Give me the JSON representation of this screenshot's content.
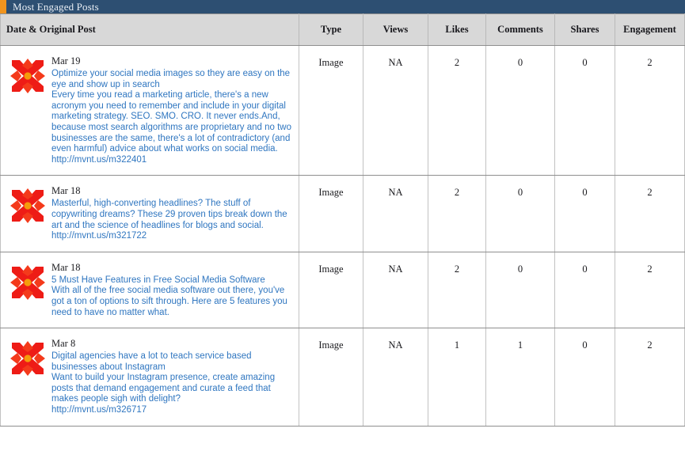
{
  "panel": {
    "title": "Most Engaged Posts",
    "accent_color": "#f0941e",
    "titlebar_color": "#2d4f72",
    "link_color": "#2f76c0"
  },
  "table": {
    "columns": [
      {
        "key": "post",
        "label": "Date & Original Post"
      },
      {
        "key": "type",
        "label": "Type"
      },
      {
        "key": "views",
        "label": "Views"
      },
      {
        "key": "likes",
        "label": "Likes"
      },
      {
        "key": "comments",
        "label": "Comments"
      },
      {
        "key": "shares",
        "label": "Shares"
      },
      {
        "key": "engagement",
        "label": "Engagement"
      }
    ],
    "rows": [
      {
        "icon": "starburst-icon",
        "date": "Mar 19",
        "text": "Optimize your social media images so they are easy on the eye and show up in search\nEvery time you read a marketing article, there's a new acronym you need to remember and include in your digital marketing strategy. SEO. SMO. CRO. It never ends.And, because most search algorithms are proprietary and no two businesses are the same, there's a lot of contradictory (and even harmful) advice about what works on social media.",
        "link": "http://mvnt.us/m322401",
        "type": "Image",
        "views": "NA",
        "likes": "2",
        "comments": "0",
        "shares": "0",
        "engagement": "2"
      },
      {
        "icon": "starburst-icon",
        "date": "Mar 18",
        "text": "Masterful, high-converting headlines? The stuff of copywriting dreams? These 29 proven tips break down the art and the science of headlines for blogs and social. http://mvnt.us/m321722",
        "link": "",
        "type": "Image",
        "views": "NA",
        "likes": "2",
        "comments": "0",
        "shares": "0",
        "engagement": "2"
      },
      {
        "icon": "starburst-icon",
        "date": "Mar 18",
        "text": "5 Must Have Features in Free Social Media Software\nWith all of the free social media software out there, you've got a ton of options to sift through. Here are 5 features you need to have no matter what.",
        "link": "",
        "type": "Image",
        "views": "NA",
        "likes": "2",
        "comments": "0",
        "shares": "0",
        "engagement": "2"
      },
      {
        "icon": "starburst-icon",
        "date": "Mar 8",
        "text": "Digital agencies have a lot to teach service based businesses about Instagram\nWant to build your Instagram presence, create amazing posts that demand engagement and curate a feed that makes people sigh with delight?",
        "link": "http://mvnt.us/m326717",
        "type": "Image",
        "views": "NA",
        "likes": "1",
        "comments": "1",
        "shares": "0",
        "engagement": "2"
      }
    ]
  }
}
